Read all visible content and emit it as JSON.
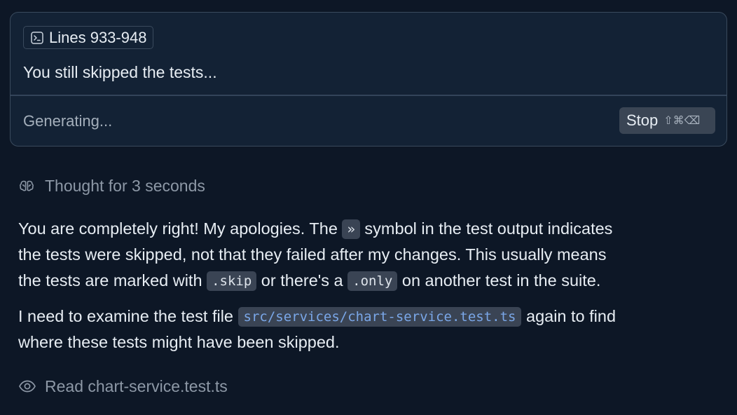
{
  "composer": {
    "context_chip": {
      "icon": "terminal-icon",
      "label": "Lines 933-948"
    },
    "prompt_text": "You still skipped the tests...",
    "status_text": "Generating...",
    "stop_button": {
      "label": "Stop",
      "shortcut": "⇧⌘⌫"
    }
  },
  "thought": {
    "icon": "brain-icon",
    "text": "Thought for 3 seconds"
  },
  "response": {
    "paragraph_1": {
      "line_1_before": "You are completely right! My apologies. The ",
      "symbol_code": "»",
      "line_1_after": " symbol in the test output indicates",
      "line_2": "the tests were skipped, not that they failed after my changes. This usually means",
      "line_3_before": "the tests are marked with ",
      "skip_code": ".skip",
      "line_3_middle": " or there's a ",
      "only_code": ".only",
      "line_3_after": " on another test in the suite."
    },
    "paragraph_2": {
      "line_1_before": "I need to examine the test file ",
      "file_path": "src/services/chart-service.test.ts",
      "line_1_after": " again to find",
      "line_2": "where these tests might have been skipped."
    }
  },
  "read_action": {
    "icon": "eye-icon",
    "text": "Read chart-service.test.ts"
  },
  "colors": {
    "background": "#0d1726",
    "panel": "#132235",
    "border": "#3a4a5d",
    "code_background": "#3a4454",
    "link_code": "#7aa7e8",
    "muted_text": "#8d98a6"
  }
}
